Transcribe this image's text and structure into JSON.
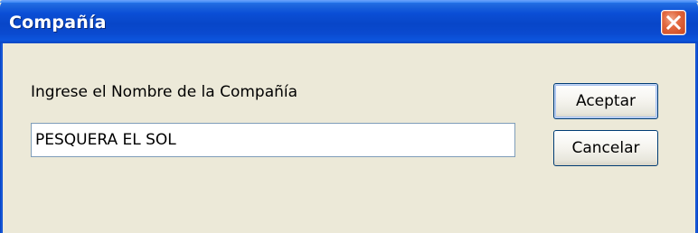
{
  "window": {
    "title": "Compañía",
    "close_icon": "close-icon"
  },
  "dialog": {
    "prompt_label": "Ingrese el Nombre de la Compañía",
    "company_name_value": "PESQUERA EL SOL"
  },
  "buttons": {
    "accept_label": "Aceptar",
    "cancel_label": "Cancelar"
  },
  "colors": {
    "titlebar": "#0a4ad0",
    "dialog_background": "#ece9d8",
    "close_button": "#e2683f"
  }
}
